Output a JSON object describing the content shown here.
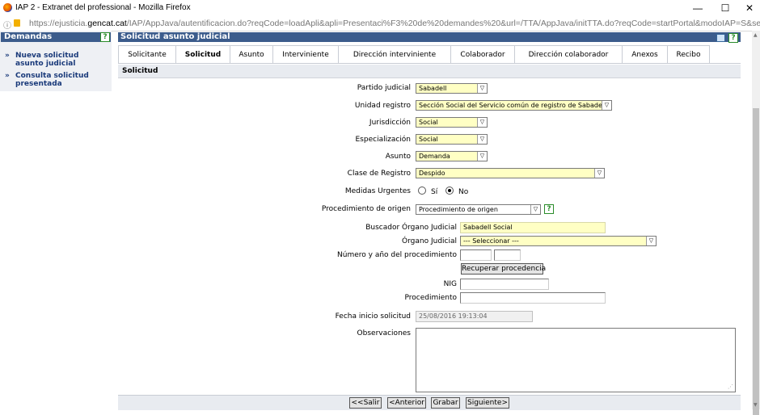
{
  "window": {
    "title": "IAP 2 - Extranet del professional - Mozilla Firefox",
    "minimize": "—",
    "maximize": "☐",
    "close": "✕"
  },
  "browser": {
    "url_prefix": "https://ejusticia.",
    "url_domain": "gencat.cat",
    "url_rest": "/IAP/AppJava/autentificacion.do?reqCode=loadApli&apli=Presentaci%F3%20de%20demandes%20&url=/TTA/AppJava/initTTA.do?reqCode=startPortal&modoIAP=S&set-locale=ca_ES&i"
  },
  "sidebar": {
    "title": "Demandas",
    "help": "?",
    "items": [
      {
        "arrow": "»",
        "label": "Nueva solicitud asunto judicial"
      },
      {
        "arrow": "»",
        "label": "Consulta solicitud presentada"
      }
    ]
  },
  "main": {
    "title": "Solicitud asunto judicial",
    "help": "?",
    "tabs": [
      {
        "label": "Solicitante"
      },
      {
        "label": "Solicitud"
      },
      {
        "label": "Asunto"
      },
      {
        "label": "Interviniente"
      },
      {
        "label": "Dirección interviniente"
      },
      {
        "label": "Colaborador"
      },
      {
        "label": "Dirección colaborador"
      },
      {
        "label": "Anexos"
      },
      {
        "label": "Recibo"
      }
    ],
    "active_tab": "Solicitud",
    "section_title": "Solicitud"
  },
  "form": {
    "partido_judicial": {
      "label": "Partido judicial",
      "value": "Sabadell"
    },
    "unidad_registro": {
      "label": "Unidad registro",
      "value": "Sección Social del Servicio común de registro de Sabadell"
    },
    "jurisdiccion": {
      "label": "Jurisdicción",
      "value": "Social"
    },
    "especializacion": {
      "label": "Especialización",
      "value": "Social"
    },
    "asunto": {
      "label": "Asunto",
      "value": "Demanda"
    },
    "clase_registro": {
      "label": "Clase de Registro",
      "value": "Despido"
    },
    "medidas_urgentes": {
      "label": "Medidas Urgentes",
      "option_si": "Sí",
      "option_no": "No",
      "selected": "No"
    },
    "procedimiento_origen": {
      "label": "Procedimiento de origen",
      "value": "Procedimiento de origen",
      "help": "?"
    },
    "buscador_organo": {
      "label": "Buscador Órgano Judicial",
      "value": "Sabadell Social"
    },
    "organo_judicial": {
      "label": "Órgano Judicial",
      "value": "--- Seleccionar ---"
    },
    "numero_anio": {
      "label": "Número y año del procedimiento",
      "numero": "",
      "anio": ""
    },
    "recuperar_button": "Recuperar procedencia",
    "nig": {
      "label": "NIG",
      "value": ""
    },
    "procedimiento": {
      "label": "Procedimiento",
      "value": ""
    },
    "fecha_inicio": {
      "label": "Fecha inicio solicitud",
      "value": "25/08/2016 19:13:04"
    },
    "observaciones": {
      "label": "Observaciones",
      "value": ""
    }
  },
  "footer": {
    "salir": "<<Salir",
    "anterior": "<Anterior",
    "grabar": "Grabar",
    "siguiente": "Siguiente>"
  },
  "colors": {
    "header_bg": "#3c5c8c",
    "field_yellow": "#ffffc4",
    "help_green": "#2a8c2a",
    "link_blue": "#1a3a7a"
  }
}
